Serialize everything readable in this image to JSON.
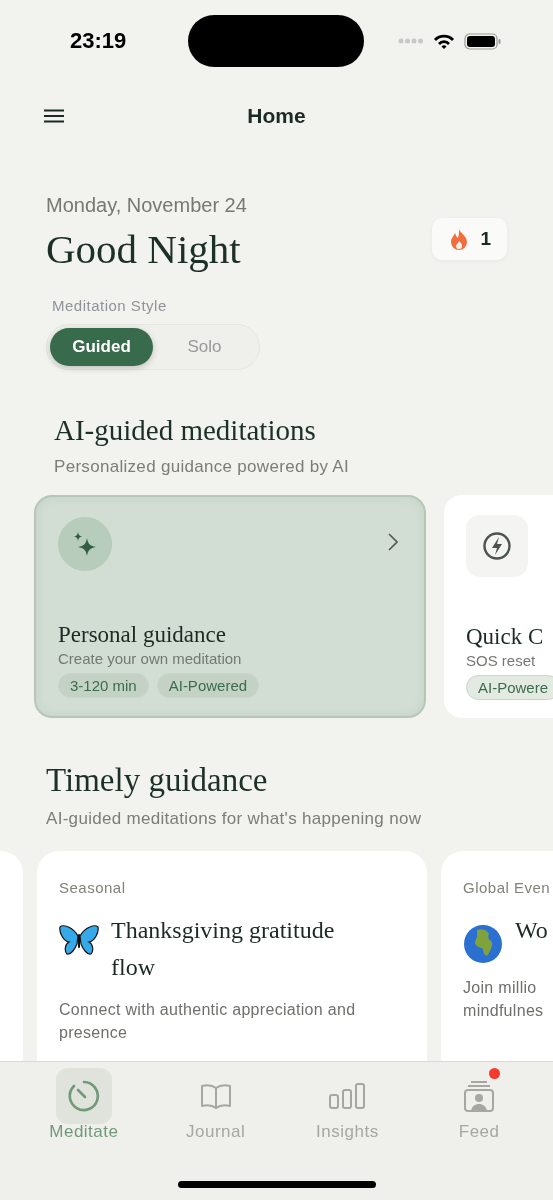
{
  "status_bar": {
    "time": "23:19"
  },
  "header": {
    "title": "Home"
  },
  "greeting": {
    "date": "Monday, November 24",
    "title": "Good Night",
    "streak": "1"
  },
  "meditation_style": {
    "label": "Meditation Style",
    "options": [
      {
        "label": "Guided",
        "selected": true
      },
      {
        "label": "Solo",
        "selected": false
      }
    ]
  },
  "ai_section": {
    "title": "AI-guided meditations",
    "subtitle": "Personalized guidance powered by AI",
    "cards": [
      {
        "kind": "sparkle",
        "highlighted": true,
        "title": "Personal guidance",
        "description": "Create your own meditation",
        "tags": [
          "3-120 min",
          "AI-Powered"
        ]
      },
      {
        "kind": "bolt",
        "highlighted": false,
        "title": "Quick C",
        "description": "SOS reset",
        "tags": [
          "AI-Powere"
        ]
      }
    ]
  },
  "timely_section": {
    "title": "Timely guidance",
    "subtitle": "AI-guided meditations for what's happening now",
    "cards": [
      {
        "kind": "butterfly",
        "category": "Seasonal",
        "title": "Thanksgiving gratitude flow",
        "description_lines": [
          "Connect with authentic appreciation and",
          "presence"
        ]
      },
      {
        "kind": "globe",
        "category": "Global Even",
        "title": "Wo",
        "description_lines": [
          "Join millio",
          "mindfulnes"
        ]
      }
    ]
  },
  "tab_bar": [
    {
      "kind": "meditate",
      "label": "Meditate",
      "selected": true,
      "badge": false
    },
    {
      "kind": "journal",
      "label": "Journal",
      "selected": false,
      "badge": false
    },
    {
      "kind": "insights",
      "label": "Insights",
      "selected": false,
      "badge": false
    },
    {
      "kind": "feed",
      "label": "Feed",
      "selected": false,
      "badge": true
    }
  ]
}
